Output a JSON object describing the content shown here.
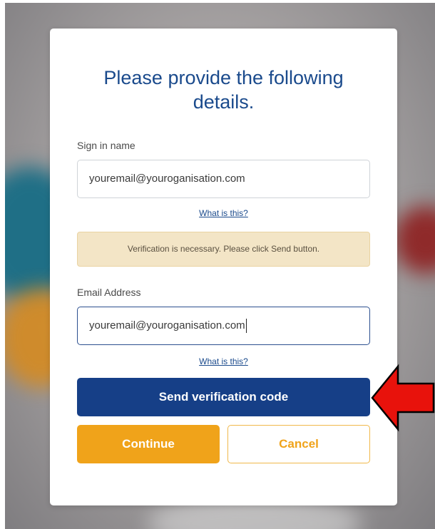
{
  "form": {
    "title": "Please provide the following details.",
    "signin_label": "Sign in name",
    "signin_value": "youremail@youroganisation.com",
    "help_link_1": "What is this?",
    "notice": "Verification is necessary. Please click Send button.",
    "email_label": "Email Address",
    "email_value": "youremail@youroganisation.com",
    "help_link_2": "What is this?"
  },
  "buttons": {
    "send": "Send verification code",
    "continue": "Continue",
    "cancel": "Cancel"
  },
  "colors": {
    "primary": "#163f87",
    "accent": "#f0a31a",
    "title": "#1a4a8c",
    "notice_bg": "#f3e5c6",
    "arrow": "#e8120c"
  },
  "annotation": {
    "icon": "red-arrow-pointer"
  }
}
